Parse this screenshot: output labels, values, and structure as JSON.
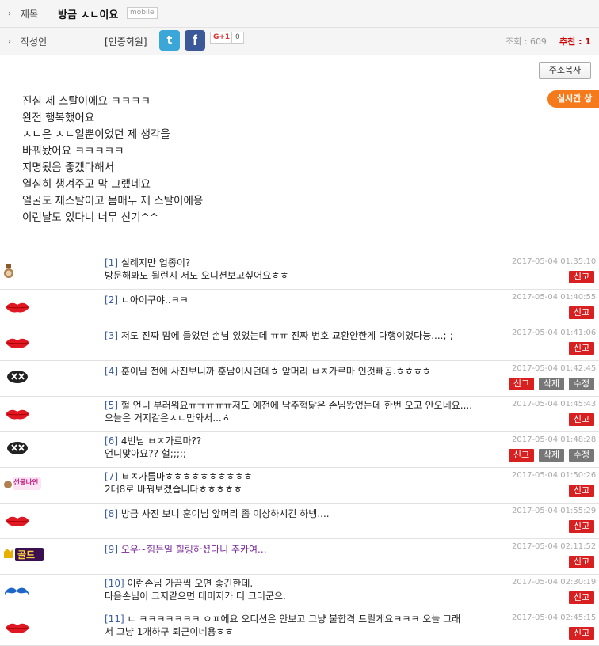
{
  "header": {
    "title_label": "제목",
    "title": "방금 ㅅㄴ이요",
    "mobile_tag": "mobile",
    "author_label": "작성인",
    "author": "[인증회원]",
    "gplus_label": "G+1",
    "gplus_count": "0",
    "views": "조회 : 609",
    "recommend": "추천 : 1"
  },
  "copy_button": "주소복사",
  "realtime_label": "실시간 상",
  "body_lines": [
    "진심 제 스탈이에요 ㅋㅋㅋㅋ",
    "완전 행복했어요",
    "ㅅㄴ은 ㅅㄴ일뿐이었던 제 생각을",
    "바꿔놨어요 ㅋㅋㅋㅋㅋ",
    "지명됬음 좋겠다해서",
    "열심히 챙겨주고 막 그랬네요",
    "얼굴도 제스탈이고 몸매두 제 스탈이에용",
    "이런날도 있다니 너무 신기^^"
  ],
  "buttons": {
    "report": "신고",
    "delete": "삭제",
    "edit": "수정"
  },
  "comments": [
    {
      "num": "[1]",
      "line1": "실례지만 업종이?",
      "line2": "방문해봐도 될런지 저도 오디션보고싶어요ㅎㅎ",
      "time": "2017-05-04 01:35:10",
      "avatar": "medal-icon"
    },
    {
      "num": "[2]",
      "line1": "ㄴ아이구야..ㅋㅋ",
      "line2": "",
      "time": "2017-05-04 01:40:55",
      "avatar": "lips-icon"
    },
    {
      "num": "[3]",
      "line1": "저도 진짜 맘에 들었던 손님 있었는데 ㅠㅠ 진짜 번호 교환안한게 다행이었다능....;-;",
      "line2": "",
      "time": "2017-05-04 01:41:06",
      "avatar": "lips-icon"
    },
    {
      "num": "[4]",
      "line1": "훈이님 전에 사진보니까 훈남이시던데ㅎ 앞머리 ㅂㅈ가르마 인것빼공.ㅎㅎㅎㅎ",
      "line2": "",
      "time": "2017-05-04 01:42:45",
      "avatar": "mask-icon"
    },
    {
      "num": "[5]",
      "line1": "헐 언니 부러워요ㅠㅠㅠㅠㅠ저도 예전에 남주혁닮은 손님왔었는데 한번 오고 안오네요....",
      "line2": "오늘은 거지같은ㅅㄴ만와서...ㅎ",
      "time": "2017-05-04 01:45:43",
      "avatar": "lips-icon"
    },
    {
      "num": "[6]",
      "line1": "4번님 ㅂㅈ가르마??",
      "line2": "언니맞아요?? 헐;;;;;",
      "time": "2017-05-04 01:48:28",
      "avatar": "mask-icon"
    },
    {
      "num": "[7]",
      "line1": "ㅂㅈ가름마ㅎㅎㅎㅎㅎㅎㅎㅎㅎㅎ",
      "line2": "2대8로 바꿔보겠습니다ㅎㅎㅎㅎㅎ",
      "time": "2017-05-04 01:50:26",
      "avatar": "badge-icon",
      "badge_text": "선물나인"
    },
    {
      "num": "[8]",
      "line1": "방금 사진 보니 훈이님 앞머리 좀 이상하시긴 하넹....",
      "line2": "",
      "time": "2017-05-04 01:55:29",
      "avatar": "lips-icon"
    },
    {
      "num": "[9]",
      "line1": "오우~힘든일 힐링하셨다니 추카여...",
      "line2": "",
      "time": "2017-05-04 02:11:52",
      "avatar": "gold-icon",
      "badge_text": "골드"
    },
    {
      "num": "[10]",
      "line1": "이런손님 가끔씩 오면 좋긴한데.",
      "line2": "다음손님이 그지같으면 데미지가 더 크더군요.",
      "time": "2017-05-04 02:30:19",
      "avatar": "mustache-icon"
    },
    {
      "num": "[11]",
      "line1": "ㄴ ㅋㅋㅋㅋㅋㅋㅋ ㅇㅍ에요 오디션은 안보고 그냥 불합격 드릴게요ㅋㅋㅋ 오늘 그래",
      "line2": "서 그냥 1개하구 퇴근이네용ㅎㅎ",
      "time": "2017-05-04 02:45:15",
      "avatar": "lips-icon"
    }
  ],
  "colors": {
    "report": "#d82020",
    "realtime": "#f57a1b",
    "comment_num": "#3b5da0",
    "comment9": "#7a2a9a"
  }
}
